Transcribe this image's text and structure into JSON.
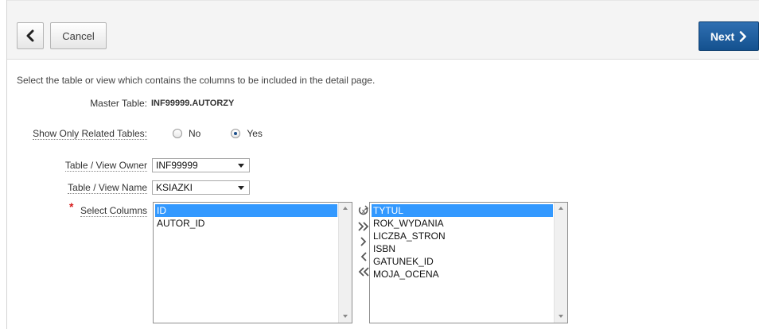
{
  "header": {
    "back_icon": "chevron-left-icon",
    "cancel_label": "Cancel",
    "next_label": "Next",
    "next_icon": "chevron-right-icon",
    "accent_color": "#1b5b9e"
  },
  "intro_text": "Select the table or view which contains the columns to be included in the detail page.",
  "master_table": {
    "label": "Master Table:",
    "value": "INF99999.AUTORZY"
  },
  "related_tables": {
    "label": "Show Only Related Tables:",
    "options": [
      {
        "label": "No",
        "checked": false
      },
      {
        "label": "Yes",
        "checked": true
      }
    ]
  },
  "owner": {
    "label": "Table / View Owner",
    "value": "INF99999"
  },
  "name": {
    "label": "Table / View Name",
    "value": "KSIAZKI"
  },
  "columns": {
    "required_mark": "*",
    "label": "Select Columns",
    "available": [
      "ID",
      "AUTOR_ID"
    ],
    "available_selected": "ID",
    "selected": [
      "TYTUL",
      "ROK_WYDANIA",
      "LICZBA_STRON",
      "ISBN",
      "GATUNEK_ID",
      "MOJA_OCENA"
    ],
    "selected_selected": "TYTUL",
    "shuttle_icons": [
      "reset-icon",
      "move-all-right-icon",
      "move-right-icon",
      "move-left-icon",
      "move-all-left-icon"
    ]
  }
}
